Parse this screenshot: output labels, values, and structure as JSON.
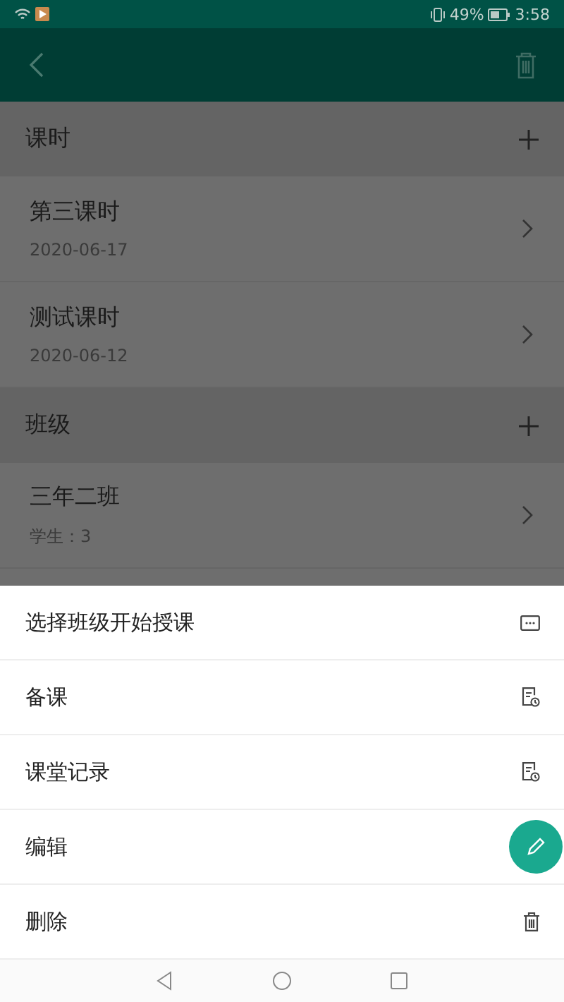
{
  "status_bar": {
    "battery": "49%",
    "time": "3:58"
  },
  "sections": [
    {
      "title": "课时",
      "items": [
        {
          "title": "第三课时",
          "subtitle": "2020-06-17"
        },
        {
          "title": "测试课时",
          "subtitle": "2020-06-12"
        }
      ]
    },
    {
      "title": "班级",
      "items": [
        {
          "title": "三年二班",
          "subtitle": "学生：3"
        }
      ]
    }
  ],
  "sheet_actions": [
    {
      "label": "选择班级开始授课",
      "kind": "more"
    },
    {
      "label": "备课",
      "kind": "document"
    },
    {
      "label": "课堂记录",
      "kind": "document"
    },
    {
      "label": "编辑",
      "kind": "edit"
    },
    {
      "label": "删除",
      "kind": "delete"
    }
  ]
}
